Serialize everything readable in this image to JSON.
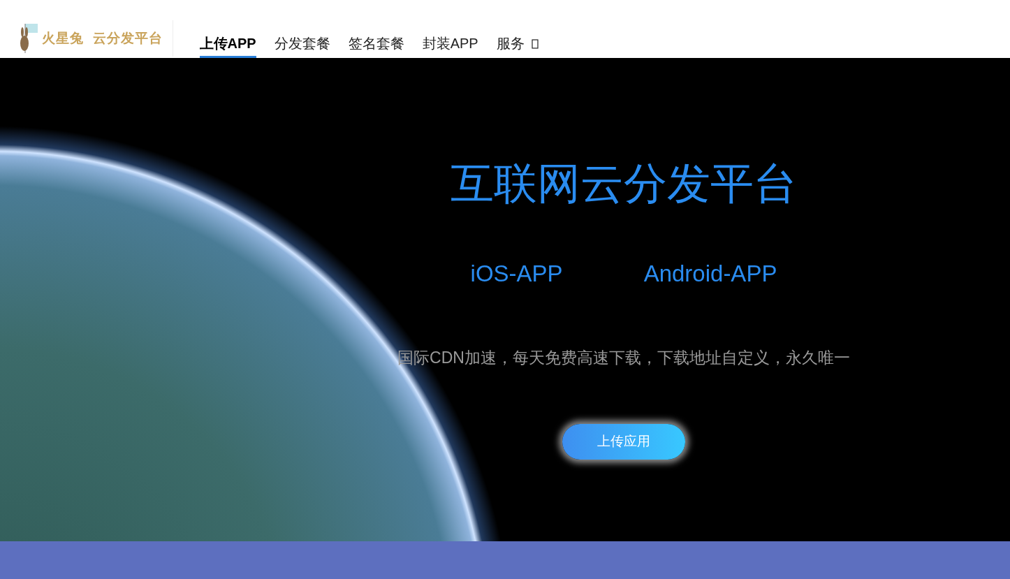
{
  "logo": {
    "text": "火星兔  云分发平台"
  },
  "nav": [
    {
      "label": "上传APP",
      "selected": true
    },
    {
      "label": "分发套餐",
      "selected": false
    },
    {
      "label": "签名套餐",
      "selected": false
    },
    {
      "label": "封装APP",
      "selected": false
    },
    {
      "label": "服务",
      "selected": false,
      "dropdown": true
    }
  ],
  "hero": {
    "title": "互联网云分发平台",
    "platforms": [
      "iOS-APP",
      "Android-APP"
    ],
    "description": "国际CDN加速，每天免费高速下载，下载地址自定义，永久唯一",
    "button": "上传应用"
  }
}
